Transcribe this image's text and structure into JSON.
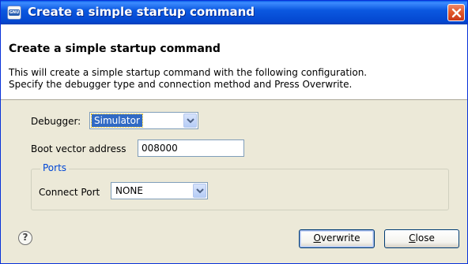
{
  "window": {
    "title": "Create a simple startup command",
    "app_icon": "gnu-icon",
    "app_icon_text": "GNU"
  },
  "header": {
    "title": "Create a simple startup command",
    "description_line1": "This will create a simple startup command with the following configuration.",
    "description_line2": "Specify the debugger type and connection method and Press Overwrite."
  },
  "form": {
    "debugger_label": "Debugger:",
    "debugger_value": "Simulator",
    "boot_vector_label": "Boot vector address",
    "boot_vector_value": "008000",
    "ports_group_label": "Ports",
    "connect_port_label": "Connect Port",
    "connect_port_value": "NONE"
  },
  "footer": {
    "help_icon": "help-icon",
    "help_glyph": "?",
    "overwrite_mnemonic": "O",
    "overwrite_rest": "verwrite",
    "close_mnemonic": "C",
    "close_rest": "lose"
  },
  "colors": {
    "titlebar": "#0b58e0",
    "dialog_bg": "#ece9d8",
    "selection": "#316ac5",
    "group_label": "#0046d5"
  }
}
